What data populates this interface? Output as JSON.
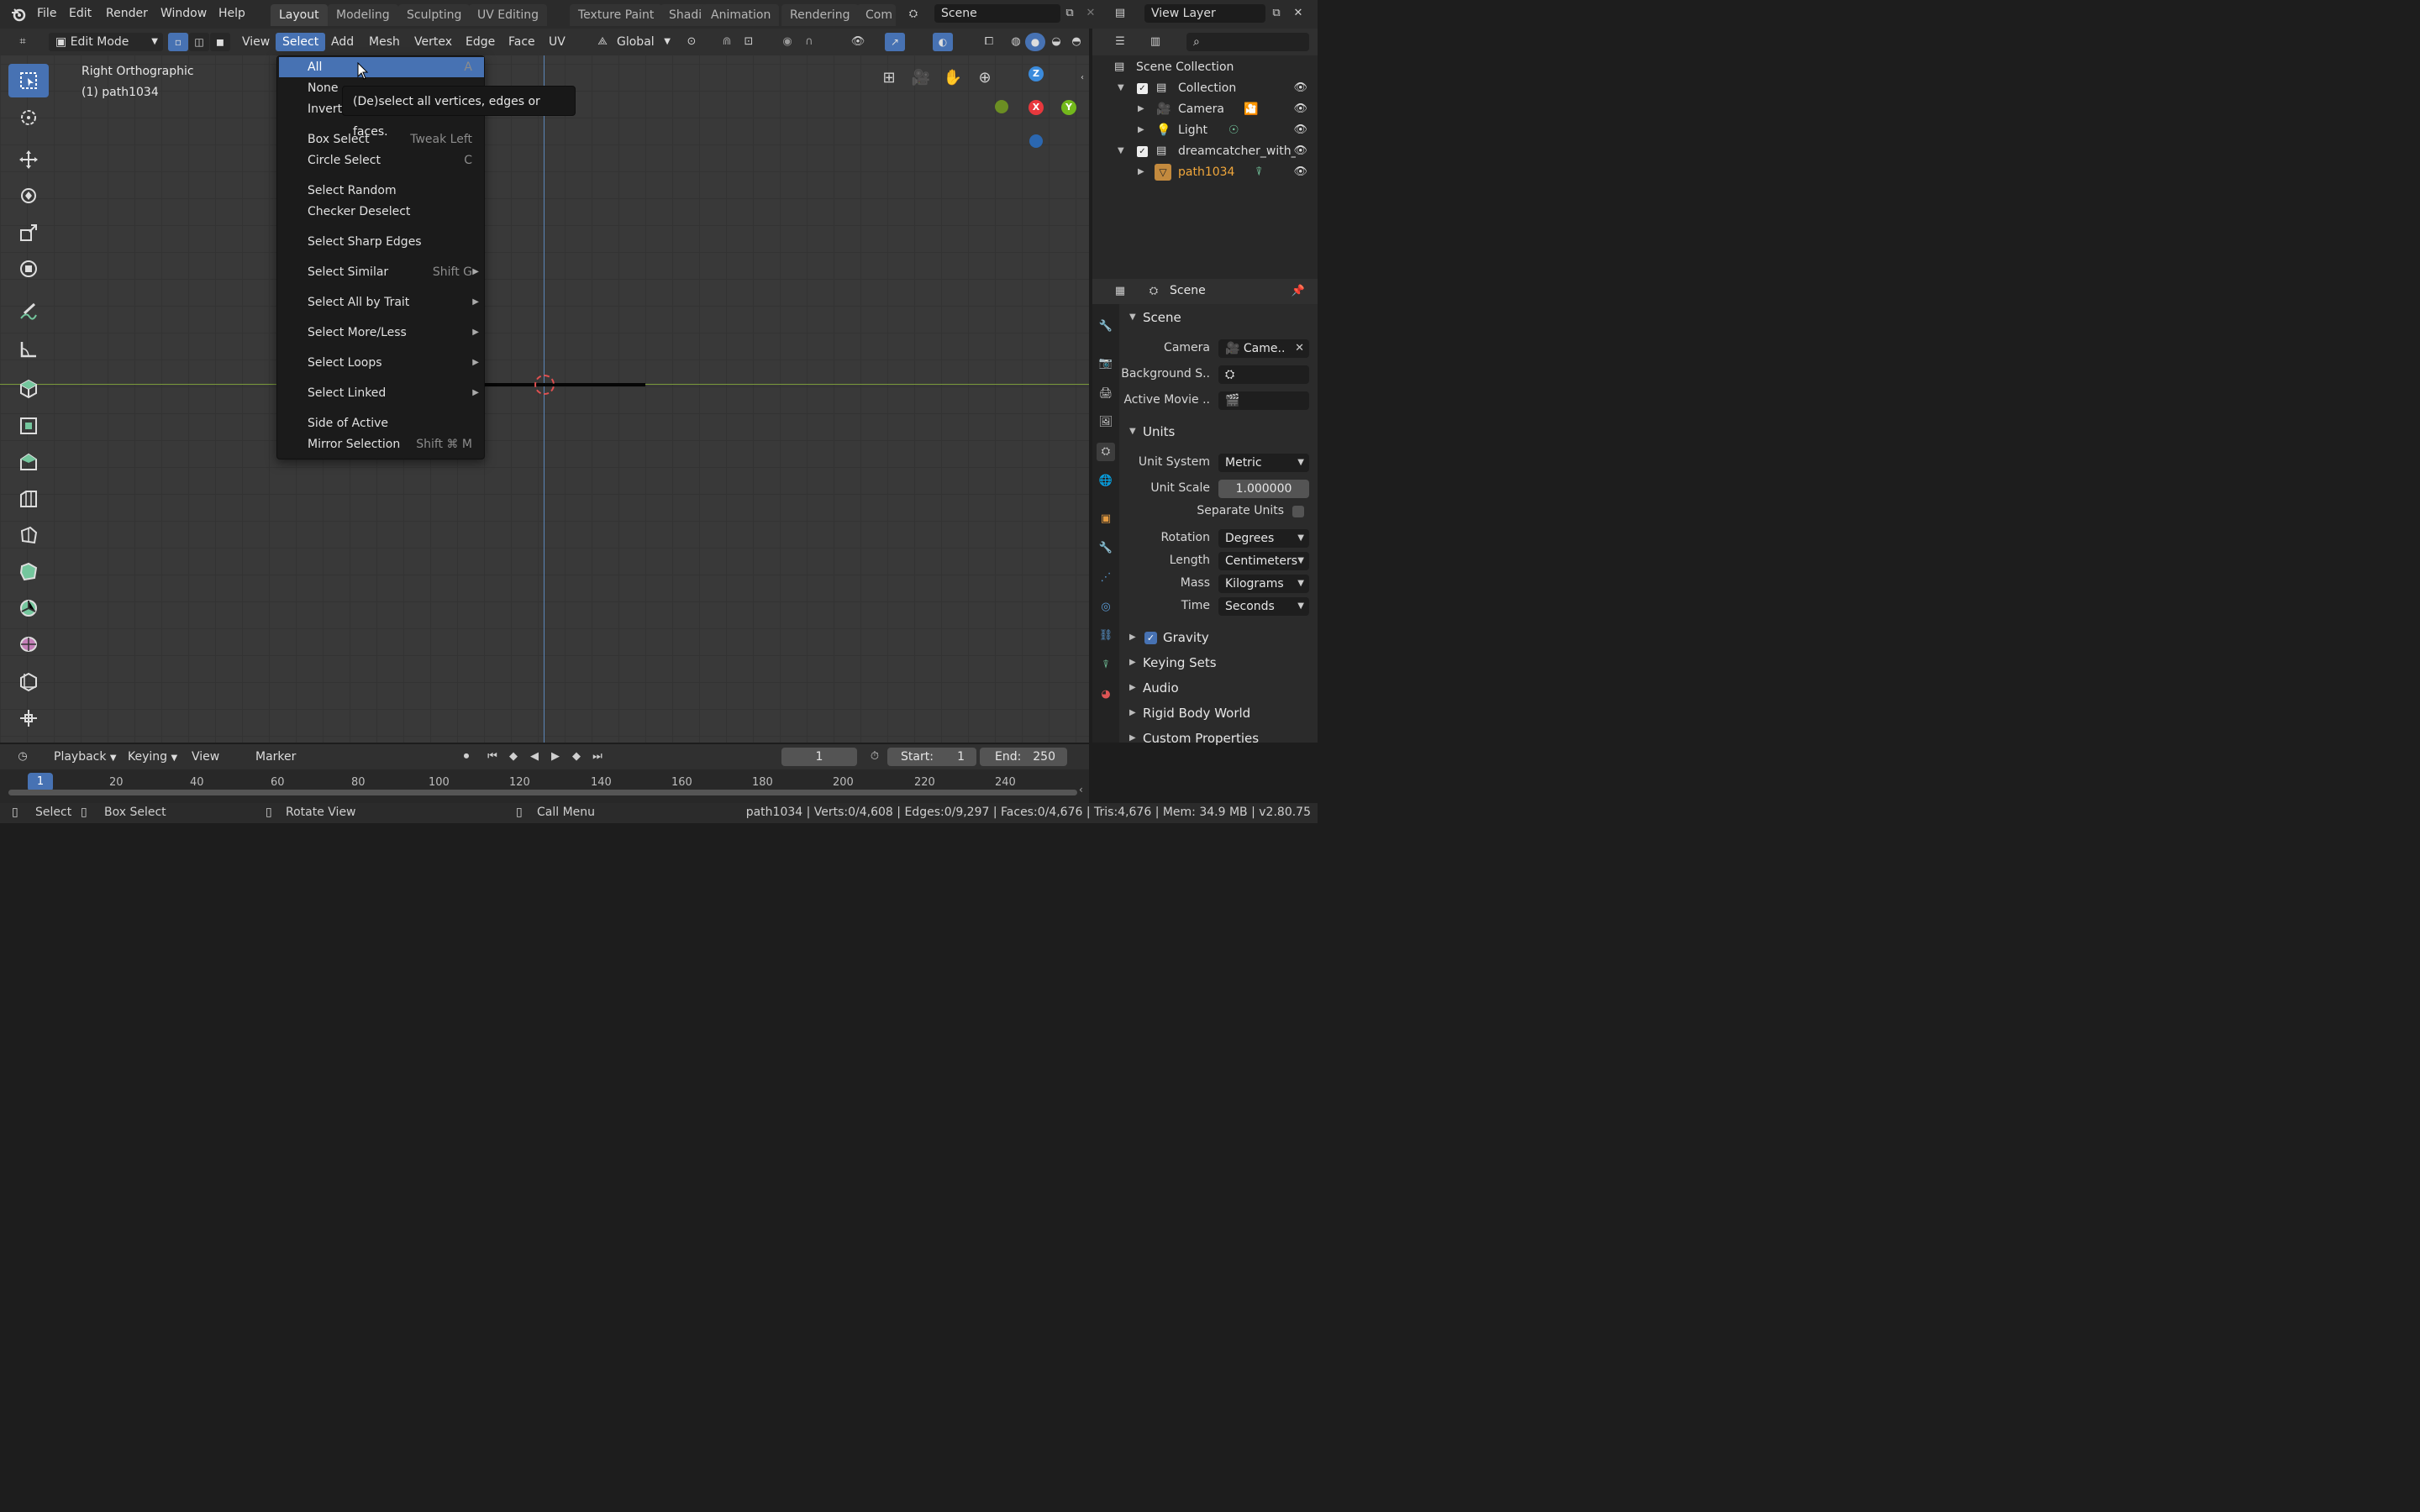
{
  "topbar": {
    "menus": [
      "File",
      "Edit",
      "Render",
      "Window",
      "Help"
    ],
    "workspaces": [
      "Layout",
      "Modeling",
      "Sculpting",
      "UV Editing",
      "Texture Paint",
      "Shading",
      "Animation",
      "Rendering",
      "Com"
    ],
    "scene": "Scene",
    "view_layer": "View Layer"
  },
  "viewport_header": {
    "mode": "Edit Mode",
    "menus": [
      "View",
      "Select",
      "Add",
      "Mesh",
      "Vertex",
      "Edge",
      "Face",
      "UV"
    ],
    "orientation": "Global"
  },
  "viewport": {
    "title": "Right Orthographic",
    "subtitle": "(1) path1034"
  },
  "select_menu": {
    "items": [
      {
        "label": "All",
        "shortcut": "A"
      },
      {
        "label": "None",
        "shortcut": ""
      },
      {
        "label": "Invert",
        "shortcut": ""
      },
      {
        "label": "Box Select",
        "shortcut": "Tweak Left"
      },
      {
        "label": "Circle Select",
        "shortcut": "C"
      },
      {
        "label": "Select Random",
        "shortcut": ""
      },
      {
        "label": "Checker Deselect",
        "shortcut": ""
      },
      {
        "label": "Select Sharp Edges",
        "shortcut": ""
      },
      {
        "label": "Select Similar",
        "shortcut": "Shift G"
      },
      {
        "label": "Select All by Trait",
        "shortcut": ""
      },
      {
        "label": "Select More/Less",
        "shortcut": ""
      },
      {
        "label": "Select Loops",
        "shortcut": ""
      },
      {
        "label": "Select Linked",
        "shortcut": ""
      },
      {
        "label": "Side of Active",
        "shortcut": ""
      },
      {
        "label": "Mirror Selection",
        "shortcut": "Shift ⌘ M"
      }
    ],
    "tooltip": "(De)select all vertices, edges or faces."
  },
  "gizmo": {
    "z": "Z",
    "x": "X",
    "y": "Y"
  },
  "outliner": {
    "root": "Scene Collection",
    "rows": [
      "Collection",
      "Camera",
      "Light",
      "dreamcatcher_with_",
      "path1034"
    ]
  },
  "properties": {
    "header": "Scene",
    "scene_panel": "Scene",
    "camera_label": "Camera",
    "camera_value": "Came..",
    "bg_label": "Background S..",
    "movie_label": "Active Movie ..",
    "units_panel": "Units",
    "unit_system_label": "Unit System",
    "unit_system": "Metric",
    "unit_scale_label": "Unit Scale",
    "unit_scale": "1.000000",
    "separate_units": "Separate Units",
    "rotation_label": "Rotation",
    "rotation": "Degrees",
    "length_label": "Length",
    "length": "Centimeters",
    "mass_label": "Mass",
    "mass": "Kilograms",
    "time_label": "Time",
    "time": "Seconds",
    "gravity": "Gravity",
    "keying_sets": "Keying Sets",
    "audio": "Audio",
    "rigid_body": "Rigid Body World",
    "custom_props": "Custom Properties"
  },
  "timeline": {
    "menus": [
      "Playback",
      "Keying",
      "View",
      "Marker"
    ],
    "current_frame": "1",
    "start_label": "Start:",
    "start": "1",
    "end_label": "End:",
    "end": "250",
    "ticks": [
      "1",
      "20",
      "40",
      "60",
      "80",
      "100",
      "120",
      "140",
      "160",
      "180",
      "200",
      "220",
      "240"
    ]
  },
  "statusbar": {
    "select": "Select",
    "box_select": "Box Select",
    "rotate_view": "Rotate View",
    "call_menu": "Call Menu",
    "stats": "path1034 | Verts:0/4,608 | Edges:0/9,297 | Faces:0/4,676 | Tris:4,676 | Mem: 34.9 MB | v2.80.75"
  },
  "colors": {
    "accent": "#4772b3",
    "x_axis": "#e8383d",
    "y_axis": "#73b81c",
    "z_axis": "#3b8bdc"
  }
}
